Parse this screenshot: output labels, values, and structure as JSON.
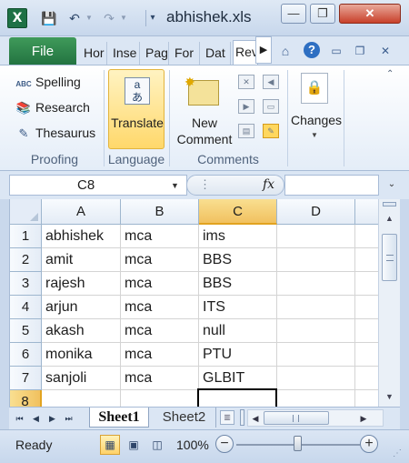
{
  "titlebar": {
    "app_icon": "excel-logo-icon",
    "file_name": "abhishek.xls",
    "quick_access": [
      "save-icon",
      "undo-icon",
      "redo-icon",
      "customize-quick-access-icon"
    ],
    "window_buttons": [
      "minimize-icon",
      "restore-icon",
      "close-icon"
    ]
  },
  "ribbon_tabs": {
    "file": "File",
    "tabs": [
      "Hor",
      "Inse",
      "Pag",
      "For",
      "Dat",
      "Rev"
    ],
    "active_tab": "Rev"
  },
  "ribbon": {
    "proofing": {
      "items": [
        {
          "label": "Spelling",
          "icon": "spelling-icon",
          "glyph": "ABC"
        },
        {
          "label": "Research",
          "icon": "research-icon",
          "glyph": "📚"
        },
        {
          "label": "Thesaurus",
          "icon": "thesaurus-icon",
          "glyph": "✎"
        }
      ],
      "group_label": "Proofing"
    },
    "language": {
      "translate_label": "Translate",
      "group_label": "Language"
    },
    "comments": {
      "new_comment_label_1": "New",
      "new_comment_label_2": "Comment",
      "group_label": "Comments"
    },
    "changes": {
      "label": "Changes"
    }
  },
  "formula_bar": {
    "name_box": "C8",
    "fx_label": "fx",
    "formula": ""
  },
  "grid": {
    "columns": [
      "A",
      "B",
      "C",
      "D"
    ],
    "rows": [
      {
        "num": "1",
        "cells": [
          "abhishek",
          "mca",
          "ims",
          ""
        ]
      },
      {
        "num": "2",
        "cells": [
          "amit",
          "mca",
          "BBS",
          ""
        ]
      },
      {
        "num": "3",
        "cells": [
          "rajesh",
          "mca",
          "BBS",
          ""
        ]
      },
      {
        "num": "4",
        "cells": [
          "arjun",
          "mca",
          "ITS",
          ""
        ]
      },
      {
        "num": "5",
        "cells": [
          "akash",
          "mca",
          "null",
          ""
        ]
      },
      {
        "num": "6",
        "cells": [
          "monika",
          "mca",
          "PTU",
          ""
        ]
      },
      {
        "num": "7",
        "cells": [
          "sanjoli",
          "mca",
          "GLBIT",
          ""
        ]
      },
      {
        "num": "8",
        "cells": [
          "",
          "",
          "",
          ""
        ]
      }
    ],
    "active_cell": "C8"
  },
  "sheets": {
    "tabs": [
      "Sheet1",
      "Sheet2"
    ],
    "active": "Sheet1"
  },
  "statusbar": {
    "status": "Ready",
    "zoom": "100%"
  },
  "colors": {
    "selected_header": "#f1c15f",
    "active_ribbon_button": "#ffd86b",
    "file_tab": "#227240"
  }
}
